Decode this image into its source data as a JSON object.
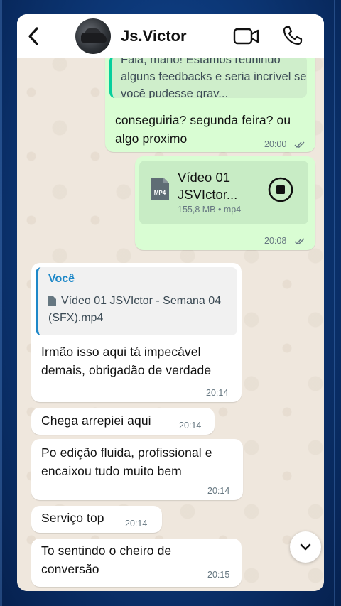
{
  "chat": {
    "contact_name": "Js.Victor"
  },
  "messages": [
    {
      "quote_text": "Fala, mano! Estamos reunindo alguns feedbacks e seria incrível se você pudesse grav...",
      "text": "conseguiria? segunda feira? ou algo proximo",
      "time": "20:00"
    },
    {
      "file_name": "Vídeo 01 JSVIctor...",
      "file_meta": "155,8 MB • mp4",
      "file_type_label": "MP4",
      "time": "20:08"
    },
    {
      "quote_author": "Você",
      "quote_text": "Vídeo 01 JSVIctor - Semana 04 (SFX).mp4",
      "text": "Irmão isso aqui tá impecável demais, obrigadão de verdade",
      "time": "20:14"
    },
    {
      "text": "Chega arrepiei aqui",
      "time": "20:14"
    },
    {
      "text": "Po edição fluida, profissional e encaixou tudo muito bem",
      "time": "20:14"
    },
    {
      "text": "Serviço top",
      "time": "20:14"
    },
    {
      "text": "To sentindo o cheiro de conversão",
      "time": "20:15"
    }
  ],
  "icons": {
    "back": "chevron-left-icon",
    "video_call": "video-camera-icon",
    "voice_call": "phone-icon",
    "read_receipt": "double-check-icon",
    "scroll_down": "chevron-down-icon"
  },
  "colors": {
    "outgoing_bubble": "#d9fdd3",
    "incoming_bubble": "#ffffff",
    "accent_green": "#06cf9c",
    "quote_blue": "#1e88c8"
  }
}
